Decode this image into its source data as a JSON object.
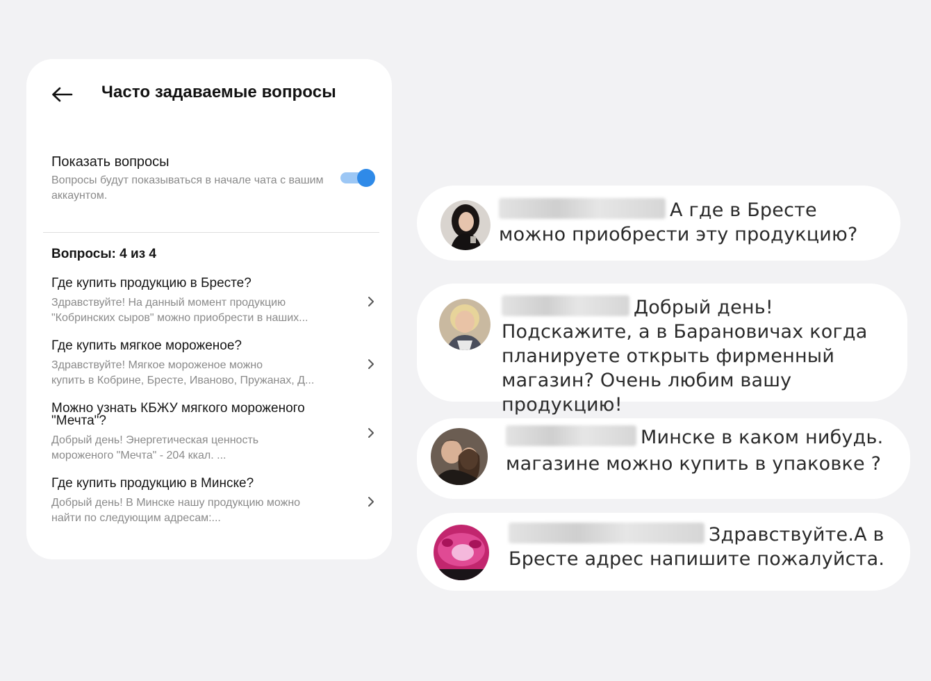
{
  "faq_screen": {
    "title": "Часто задаваемые вопросы",
    "show_questions": {
      "label": "Показать вопросы",
      "description": "Вопросы будут показываться в начале чата с вашим аккаунтом.",
      "enabled": true
    },
    "count_label": "Вопросы: 4 из 4",
    "questions": [
      {
        "question": "Где купить продукцию в Бресте?",
        "answer_lines": [
          "Здравствуйте! На данный момент продукцию",
          "\"Кобринских сыров\" можно приобрести в наших..."
        ]
      },
      {
        "question": "Где купить мягкое мороженое?",
        "answer_lines": [
          "Здравствуйте! Мягкое мороженое можно",
          "купить в Кобрине, Бресте, Иваново, Пружанах, Д..."
        ]
      },
      {
        "question": "Можно узнать КБЖУ мягкого мороженого \"Мечта\"?",
        "answer_lines": [
          "Добрый день! Энергетическая ценность",
          "мороженого \"Мечта\" - 204 ккал. ..."
        ]
      },
      {
        "question": "Где купить продукцию в Минске?",
        "answer_lines": [
          "Добрый день! В Минске нашу продукцию можно",
          "найти по следующим адресам:..."
        ]
      }
    ]
  },
  "comments": [
    {
      "text": "А где в Бресте можно приобрести эту продукцию?",
      "avatar": "avatar-woman-dark-hair"
    },
    {
      "text": "Добрый день! Подскажите, а в Барановичах когда планируете открыть фирменный магазин? Очень любим вашу продукцию!",
      "avatar": "avatar-woman-blonde"
    },
    {
      "text": "Минске в каком нибудь. магазине можно купить в упаковке ?",
      "avatar": "avatar-couple"
    },
    {
      "text": "Здравствуйте.А в Бресте адрес напишите пожалуйста.",
      "avatar": "avatar-pink-flowers"
    }
  ],
  "colors": {
    "background": "#f2f2f4",
    "card": "#ffffff",
    "toggle_on": "#2f8ae8",
    "toggle_track": "#9cc7f5",
    "secondary_text": "#8a8a8a"
  }
}
